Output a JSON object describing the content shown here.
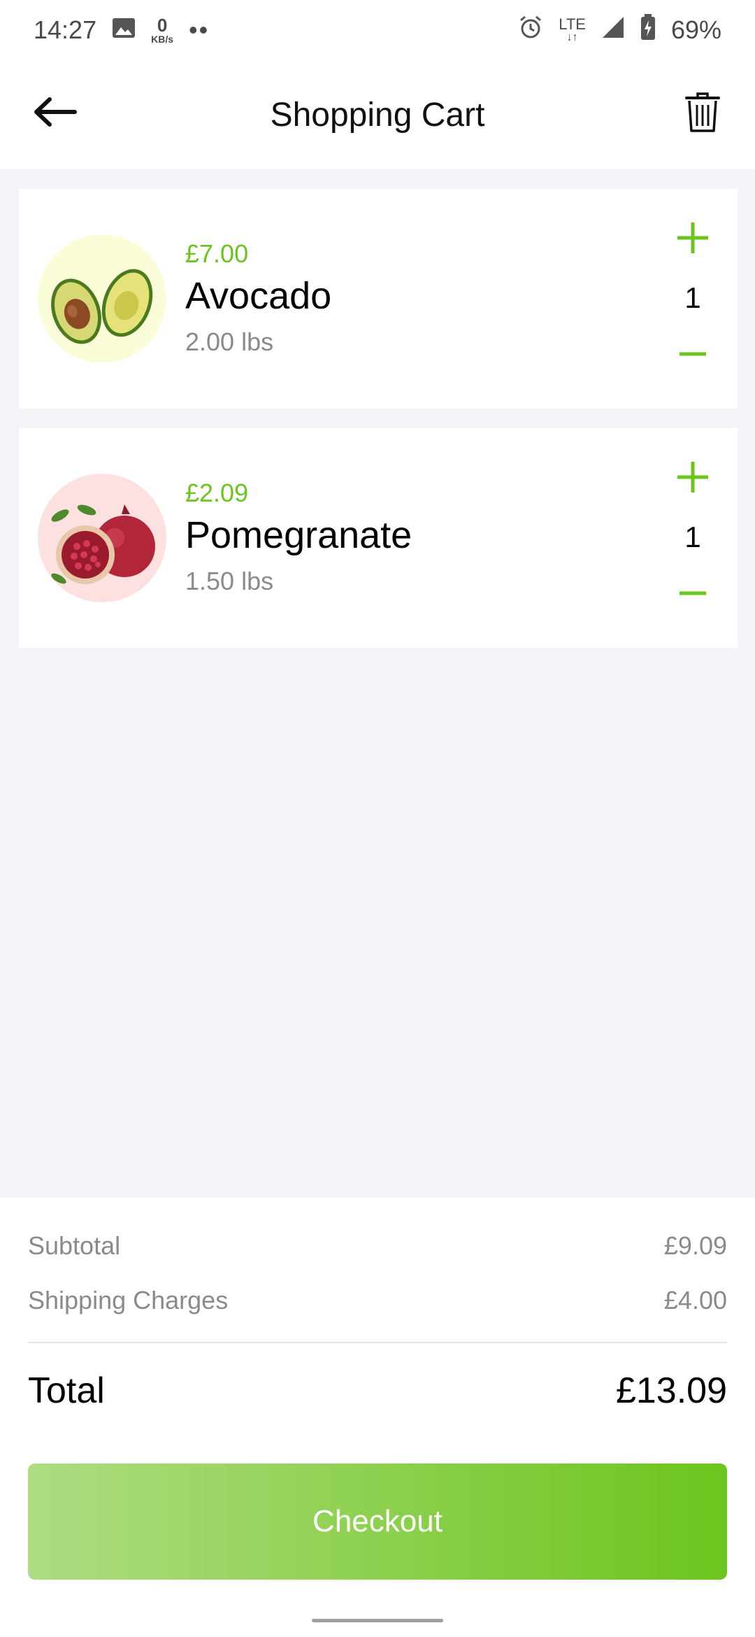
{
  "status_bar": {
    "time": "14:27",
    "net_speed_value": "0",
    "net_speed_unit": "KB/s",
    "dots": "••",
    "lte": "LTE",
    "battery": "69%"
  },
  "header": {
    "title": "Shopping Cart"
  },
  "cart": {
    "items": [
      {
        "price": "£7.00",
        "name": "Avocado",
        "weight": "2.00 lbs",
        "quantity": "1"
      },
      {
        "price": "£2.09",
        "name": "Pomegranate",
        "weight": "1.50 lbs",
        "quantity": "1"
      }
    ]
  },
  "summary": {
    "subtotal_label": "Subtotal",
    "subtotal_value": "£9.09",
    "shipping_label": "Shipping Charges",
    "shipping_value": "£4.00",
    "total_label": "Total",
    "total_value": "£13.09",
    "checkout_label": "Checkout"
  },
  "colors": {
    "accent": "#6cc51d",
    "accent_light": "#aedc81",
    "background": "#f3f4f8",
    "avocado_bg": "#fbfdd8",
    "pomegranate_bg": "#fde0e0"
  },
  "icons": {
    "back": "arrow-left-icon",
    "delete": "trash-icon",
    "increase": "plus-icon",
    "decrease": "minus-icon"
  }
}
